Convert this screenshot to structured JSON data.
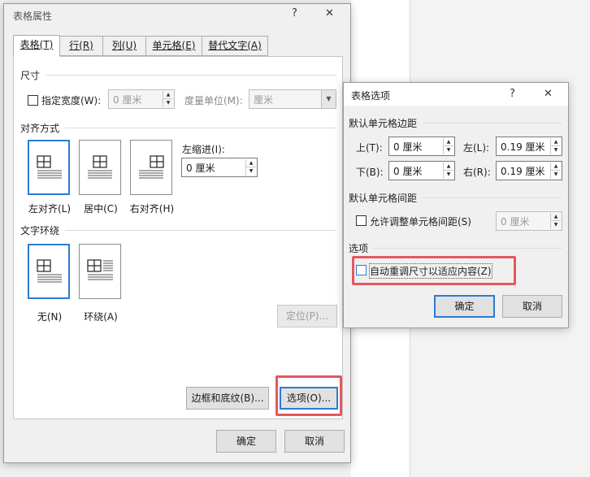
{
  "table_properties": {
    "title": "表格属性",
    "help_label": "?",
    "close_label": "✕",
    "tabs": [
      {
        "label": "表格(T)"
      },
      {
        "label": "行(R)"
      },
      {
        "label": "列(U)"
      },
      {
        "label": "单元格(E)"
      },
      {
        "label": "替代文字(A)"
      }
    ],
    "size": {
      "section_label": "尺寸",
      "preferred_width_label": "指定宽度(W):",
      "preferred_width_value": "0 厘米",
      "measure_label": "度量单位(M):",
      "measure_value": "厘米"
    },
    "alignment": {
      "section_label": "对齐方式",
      "options": [
        {
          "label": "左对齐(L)"
        },
        {
          "label": "居中(C)"
        },
        {
          "label": "右对齐(H)"
        }
      ],
      "indent_label": "左缩进(I):",
      "indent_value": "0 厘米"
    },
    "wrapping": {
      "section_label": "文字环绕",
      "options": [
        {
          "label": "无(N)"
        },
        {
          "label": "环绕(A)"
        }
      ],
      "positioning_label": "定位(P)..."
    },
    "borders_label": "边框和底纹(B)...",
    "options_label": "选项(O)...",
    "ok_label": "确定",
    "cancel_label": "取消"
  },
  "table_options": {
    "title": "表格选项",
    "help_label": "?",
    "close_label": "✕",
    "margins": {
      "section_label": "默认单元格边距",
      "top_label": "上(T):",
      "top_value": "0 厘米",
      "left_label": "左(L):",
      "left_value": "0.19 厘米",
      "bottom_label": "下(B):",
      "bottom_value": "0 厘米",
      "right_label": "右(R):",
      "right_value": "0.19 厘米"
    },
    "spacing": {
      "section_label": "默认单元格间距",
      "allow_label": "允许调整单元格间距(S)",
      "value": "0 厘米"
    },
    "options": {
      "section_label": "选项",
      "autoresize_label": "自动重调尺寸以适应内容(Z)"
    },
    "ok_label": "确定",
    "cancel_label": "取消"
  }
}
